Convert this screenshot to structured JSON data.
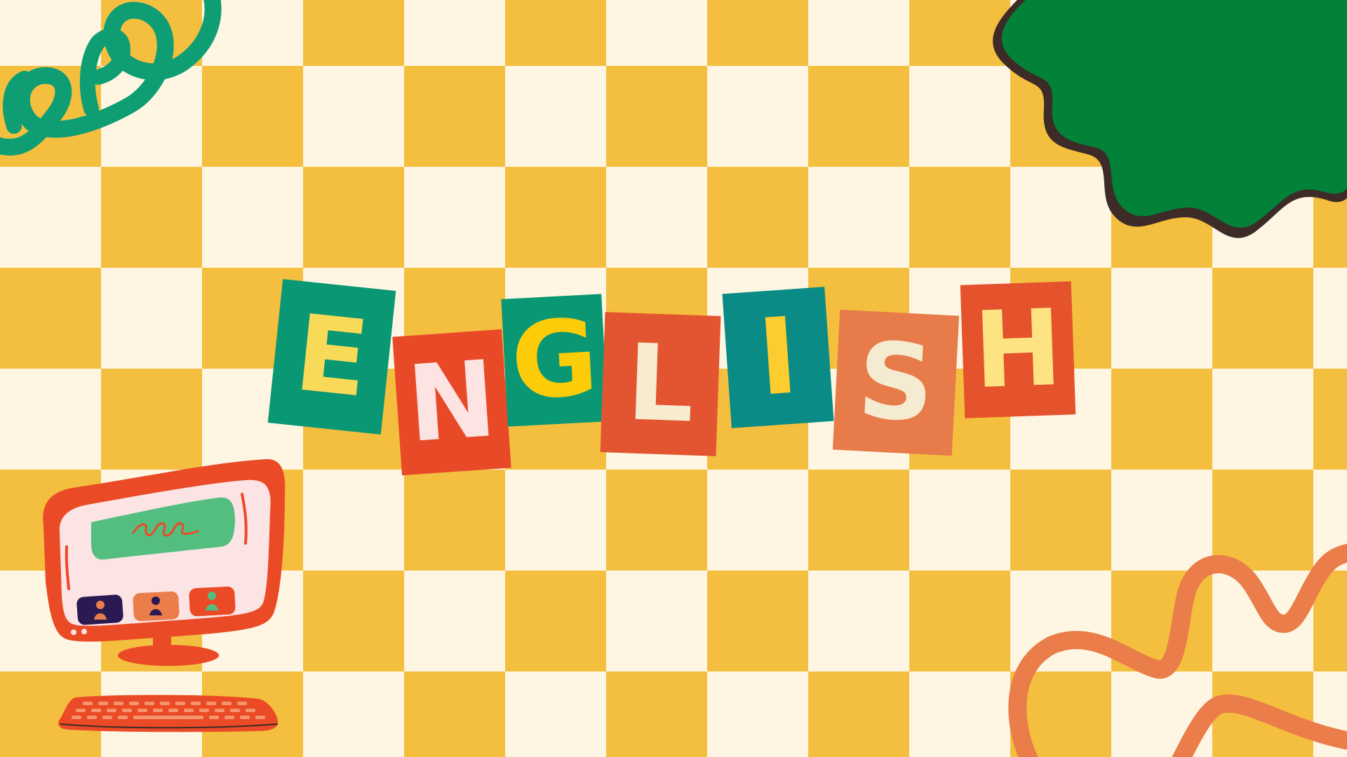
{
  "title": {
    "text": "ENGLISH",
    "tiles": [
      {
        "letter": "E",
        "bg": "#0A9774",
        "fg": "#F9DA58"
      },
      {
        "letter": "N",
        "bg": "#E84A27",
        "fg": "#FDE4E2"
      },
      {
        "letter": "G",
        "bg": "#0A9774",
        "fg": "#FDCC09"
      },
      {
        "letter": "L",
        "bg": "#E35531",
        "fg": "#F7EBD0"
      },
      {
        "letter": "I",
        "bg": "#0A8B86",
        "fg": "#FDCC2E"
      },
      {
        "letter": "S",
        "bg": "#E87B4A",
        "fg": "#F5EBD1"
      },
      {
        "letter": "H",
        "bg": "#E5532C",
        "fg": "#FEE383"
      }
    ]
  },
  "palette": {
    "checker_yellow": "#F4BF3E",
    "checker_cream": "#FEF6E2",
    "spring_green": "#0F9E73",
    "blob_green": "#028239",
    "blob_outline": "#3C2B26",
    "squiggle_orange": "#EA7D49",
    "monitor_red": "#EB4A26",
    "screen_pink": "#FCE3E4",
    "screen_green": "#53BE80"
  },
  "decorations": [
    "coil-spring-icon",
    "wavy-blob-shape",
    "computer-monitor-icon",
    "keyboard-icon",
    "squiggle-line-shape"
  ]
}
